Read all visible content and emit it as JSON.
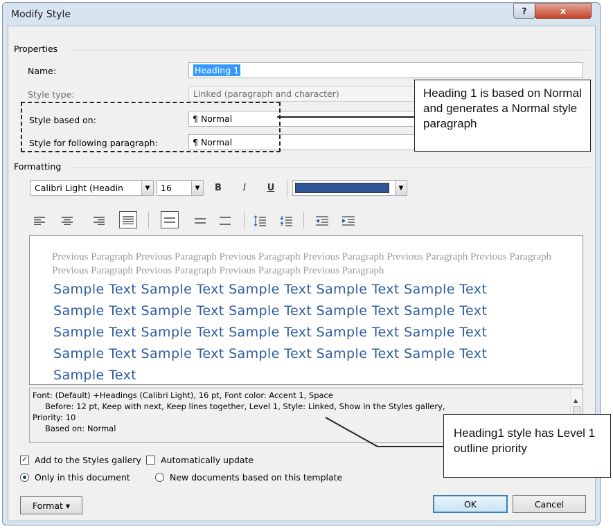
{
  "window": {
    "title": "Modify Style",
    "help_label": "?",
    "close_label": "x"
  },
  "properties": {
    "heading": "Properties",
    "name_label": "Name:",
    "name_value": "Heading 1",
    "style_type_label": "Style type:",
    "style_type_value": "Linked (paragraph and character)",
    "based_on_label": "Style based on:",
    "based_on_value": "Normal",
    "following_label": "Style for following paragraph:",
    "following_value": "Normal"
  },
  "formatting": {
    "heading": "Formatting",
    "font_value": "Calibri Light (Headin",
    "size_value": "16",
    "bold_label": "B",
    "italic_label": "I",
    "underline_label": "U",
    "font_color": "#2f5597"
  },
  "preview": {
    "previous_paragraph": "Previous Paragraph Previous Paragraph Previous Paragraph Previous Paragraph Previous Paragraph Previous Paragraph Previous Paragraph Previous Paragraph Previous Paragraph Previous Paragraph",
    "sample_lines": [
      "Sample Text Sample Text Sample Text Sample Text Sample Text",
      "Sample Text Sample Text Sample Text Sample Text Sample Text",
      "Sample Text Sample Text Sample Text Sample Text Sample Text",
      "Sample Text Sample Text Sample Text Sample Text Sample Text",
      "Sample Text"
    ]
  },
  "description": {
    "lines": [
      "Font: (Default) +Headings (Calibri Light), 16 pt, Font color: Accent 1, Space",
      "Before:  12 pt, Keep with next, Keep lines together, Level 1, Style: Linked, Show in the Styles gallery,",
      "Priority: 10",
      "Based on: Normal"
    ]
  },
  "options": {
    "add_to_gallery_label": "Add to the Styles gallery",
    "add_to_gallery_checked": true,
    "auto_update_label": "Automatically update",
    "auto_update_checked": false,
    "only_document_label": "Only in this document",
    "new_documents_label": "New documents based on this template",
    "selected_scope": "only_document"
  },
  "buttons": {
    "format_label": "Format ▾",
    "ok_label": "OK",
    "cancel_label": "Cancel"
  },
  "callouts": {
    "based_on_note": "Heading 1 is based on Normal and generates a Normal style paragraph",
    "level_note": "Heading1 style has Level 1 outline priority"
  },
  "icons": {
    "paragraph_mark": "¶",
    "align_left": "align-left-icon",
    "center": "align-center-icon",
    "align_right": "align-right-icon",
    "justify": "justify-icon"
  }
}
